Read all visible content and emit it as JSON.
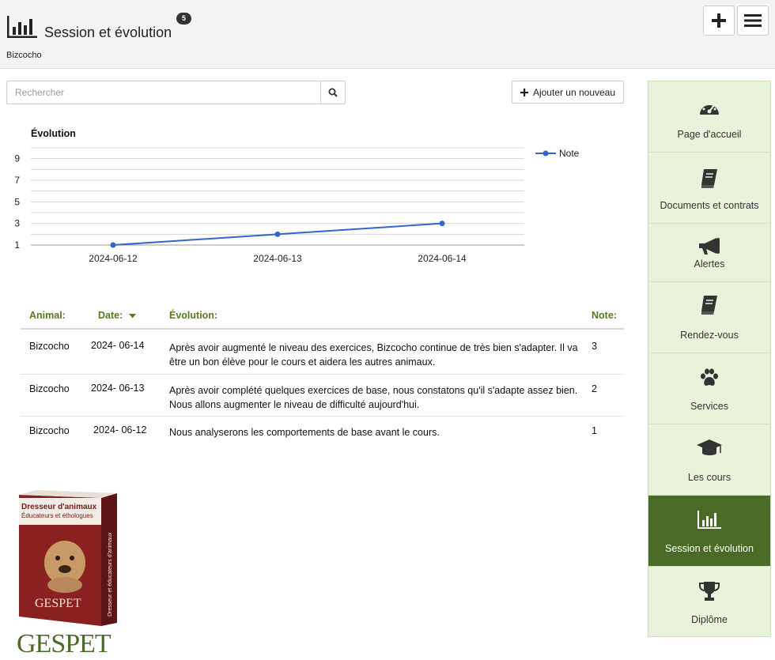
{
  "header": {
    "title": "Session et évolution",
    "badge_count": "5",
    "subtitle": "Bizcocho"
  },
  "search": {
    "placeholder": "Rechercher",
    "value": ""
  },
  "add_new_label": "Ajouter un nouveau",
  "chart_data": {
    "type": "line",
    "title": "Évolution",
    "categories": [
      "2024-06-12",
      "2024-06-13",
      "2024-06-14"
    ],
    "series": [
      {
        "name": "Note",
        "values": [
          1,
          2,
          3
        ],
        "color": "#3366cc"
      }
    ],
    "y_ticks": [
      "1",
      "3",
      "5",
      "7",
      "9"
    ],
    "ylim": [
      1,
      10
    ],
    "grid": true,
    "legend_position": "top-right"
  },
  "table": {
    "headers": {
      "animal": "Animal:",
      "date": "Date:",
      "evolution": "Évolution:",
      "note": "Note:"
    },
    "rows": [
      {
        "animal": "Bizcocho",
        "date": "2024- 06-14",
        "evolution": "Après avoir augmenté le niveau des exercices, Bizcocho continue de très bien s'adapter. Il va être un bon élève pour le cours et aidera les autres animaux.",
        "note": "3"
      },
      {
        "animal": "Bizcocho",
        "date": "2024- 06-13",
        "evolution": "Après avoir complété quelques exercices de base, nous constatons qu'il s'adapte assez bien. Nous allons augmenter le niveau de difficulté aujourd'hui.",
        "note": "2"
      },
      {
        "animal": "Bizcocho",
        "date": "2024- 06-12",
        "evolution": "Nous analyserons les comportements de base avant le cours.",
        "note": "1"
      }
    ]
  },
  "sidebar": {
    "items": [
      {
        "label": "Page d'accueil",
        "icon": "dashboard-icon"
      },
      {
        "label": "Documents et contrats",
        "icon": "book-icon"
      },
      {
        "label": "Alertes",
        "icon": "megaphone-icon"
      },
      {
        "label": "Rendez-vous",
        "icon": "book-icon"
      },
      {
        "label": "Services",
        "icon": "paw-icon"
      },
      {
        "label": "Les cours",
        "icon": "graduation-cap-icon"
      },
      {
        "label": "Session et évolution",
        "icon": "bar-chart-icon",
        "active": true
      },
      {
        "label": "Diplôme",
        "icon": "trophy-icon"
      }
    ]
  },
  "product": {
    "box_title": "Dresseur d'animaux",
    "box_subtitle": "Éducateurs et éthologues",
    "box_brand": "GESPET",
    "box_side_text": "Dresseur et éducateurs d'animaux",
    "logo_text": "GESPET"
  },
  "colors": {
    "accent_green": "#4a6b27",
    "header_green_text": "#5b7a20",
    "line_blue": "#3366cc",
    "sidebar_bg": "#e9f3dc"
  }
}
